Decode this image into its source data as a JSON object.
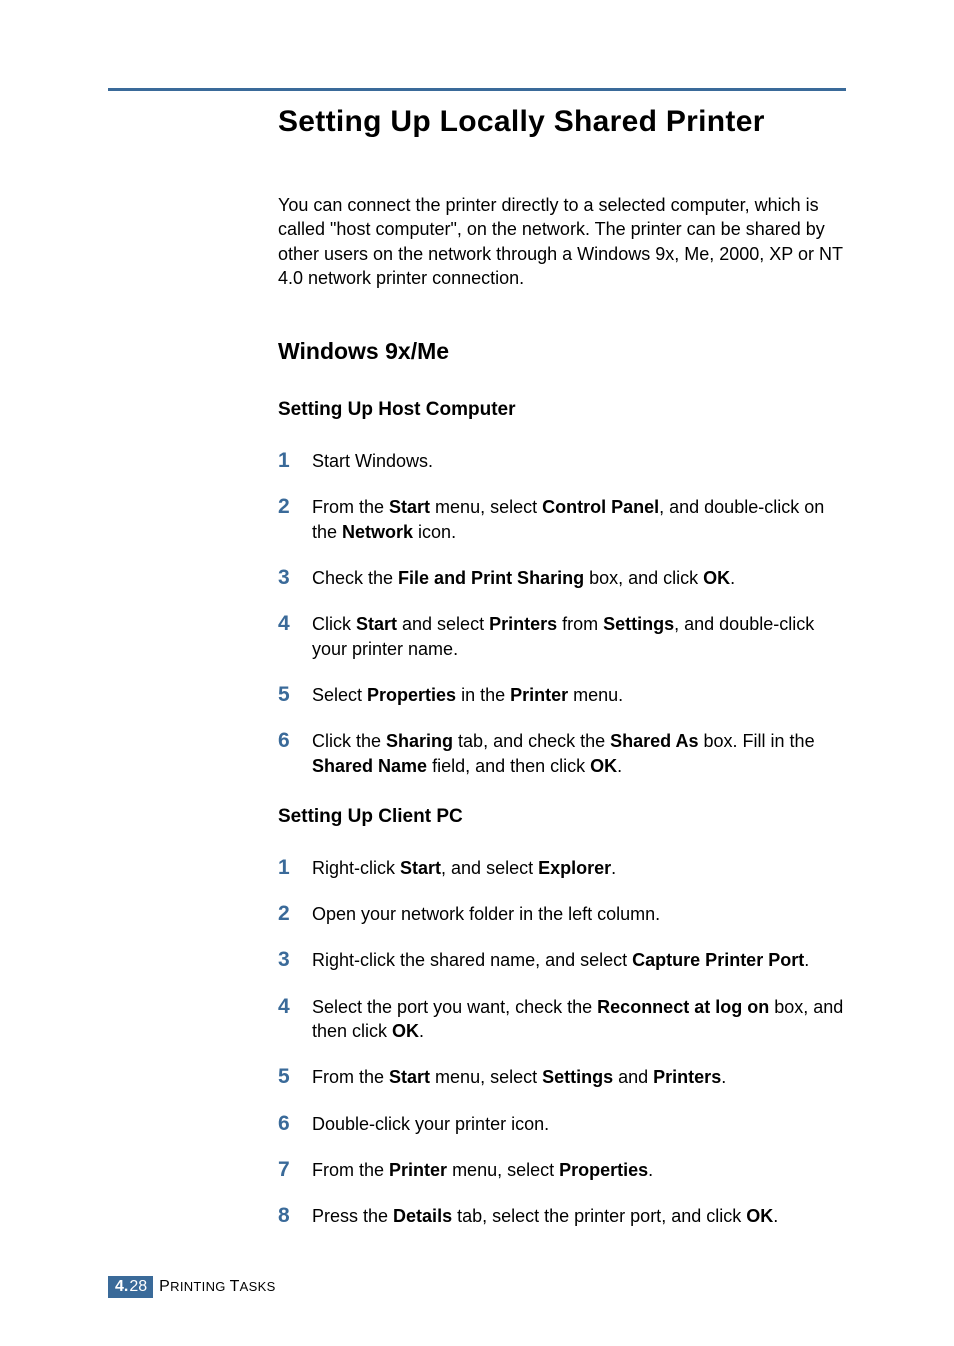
{
  "title": "Setting Up Locally Shared Printer",
  "intro": "You can connect the printer directly to a selected computer, which is called \"host computer\", on the network. The printer can be shared by other users on the network through a Windows 9x, Me, 2000, XP or NT 4.0 network printer connection.",
  "section1": {
    "heading": "Windows 9x/Me",
    "sub1": {
      "heading": "Setting Up Host Computer",
      "steps": [
        {
          "n": "1",
          "html": "Start Windows."
        },
        {
          "n": "2",
          "html": "From the <b>Start</b> menu, select <b>Control Panel</b>, and double-click on the <b>Network</b> icon."
        },
        {
          "n": "3",
          "html": "Check the <b>File and Print Sharing</b> box, and click <b>OK</b>."
        },
        {
          "n": "4",
          "html": "Click <b>Start</b> and select <b>Printers</b> from <b>Settings</b>, and double-click your printer name."
        },
        {
          "n": "5",
          "html": "Select <b>Properties</b> in the <b>Printer</b> menu."
        },
        {
          "n": "6",
          "html": "Click the <b>Sharing</b> tab, and check the <b>Shared As</b> box. Fill in the <b>Shared Name</b> field, and then click <b>OK</b>."
        }
      ]
    },
    "sub2": {
      "heading": "Setting Up Client PC",
      "steps": [
        {
          "n": "1",
          "html": "Right-click <b>Start</b>, and select <b>Explorer</b>."
        },
        {
          "n": "2",
          "html": "Open your network folder in the left column."
        },
        {
          "n": "3",
          "html": "Right-click the shared name, and select <b>Capture Printer Port</b>."
        },
        {
          "n": "4",
          "html": "Select the port you want, check the <b>Reconnect at log on</b> box, and then click <b>OK</b>."
        },
        {
          "n": "5",
          "html": "From the <b>Start</b> menu, select <b>Settings</b> and <b>Printers</b>."
        },
        {
          "n": "6",
          "html": "Double-click your printer icon."
        },
        {
          "n": "7",
          "html": "From the <b>Printer</b> menu, select <b>Properties</b>."
        },
        {
          "n": "8",
          "html": "Press the <b>Details</b> tab, select the printer port, and click <b>OK</b>."
        }
      ]
    }
  },
  "footer": {
    "chapter": "4.",
    "page": "28",
    "label": "PRINTING TASKS"
  }
}
